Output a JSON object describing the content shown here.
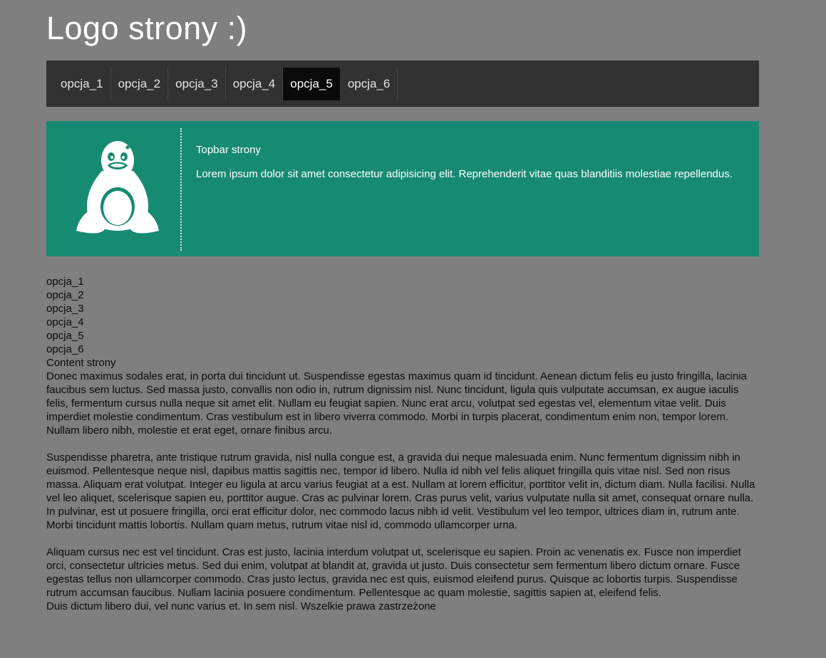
{
  "logo": "Logo strony :)",
  "nav": {
    "items": [
      "opcja_1",
      "opcja_2",
      "opcja_3",
      "opcja_4",
      "opcja_5",
      "opcja_6"
    ],
    "active_index": 4
  },
  "topbar": {
    "icon": "linux-penguin-icon",
    "title": "Topbar strony",
    "text": "Lorem ipsum dolor sit amet consectetur adipisicing elit. Reprehenderit vitae quas blanditiis molestiae repellendus."
  },
  "sidebar_list": [
    "opcja_1",
    "opcja_2",
    "opcja_3",
    "opcja_4",
    "opcja_5",
    "opcja_6"
  ],
  "content": {
    "title": "Content strony",
    "paragraphs": [
      "Donec maximus sodales erat, in porta dui tincidunt ut. Suspendisse egestas maximus quam id tincidunt. Aenean dictum felis eu justo fringilla, lacinia faucibus sem luctus. Sed massa justo, convallis non odio in, rutrum dignissim nisl. Nunc tincidunt, ligula quis vulputate accumsan, ex augue iaculis felis, fermentum cursus nulla neque sit amet elit. Nullam eu feugiat sapien. Nunc erat arcu, volutpat sed egestas vel, elementum vitae velit. Duis imperdiet molestie condimentum. Cras vestibulum est in libero viverra commodo. Morbi in turpis placerat, condimentum enim non, tempor lorem. Nullam libero nibh, molestie et erat eget, ornare finibus arcu.",
      "Suspendisse pharetra, ante tristique rutrum gravida, nisl nulla congue est, a gravida dui neque malesuada enim. Nunc fermentum dignissim nibh in euismod. Pellentesque neque nisl, dapibus mattis sagittis nec, tempor id libero. Nulla id nibh vel felis aliquet fringilla quis vitae nisl. Sed non risus massa. Aliquam erat volutpat. Integer eu ligula at arcu varius feugiat at a est. Nullam at lorem efficitur, porttitor velit in, dictum diam. Nulla facilisi. Nulla vel leo aliquet, scelerisque sapien eu, porttitor augue. Cras ac pulvinar lorem. Cras purus velit, varius vulputate nulla sit amet, consequat ornare nulla. In pulvinar, est ut posuere fringilla, orci erat efficitur dolor, nec commodo lacus nibh id velit. Vestibulum vel leo tempor, ultrices diam in, rutrum ante. Morbi tincidunt mattis lobortis. Nullam quam metus, rutrum vitae nisl id, commodo ullamcorper urna.",
      "Aliquam cursus nec est vel tincidunt. Cras est justo, lacinia interdum volutpat ut, scelerisque eu sapien. Proin ac venenatis ex. Fusce non imperdiet orci, consectetur ultricies metus. Sed dui enim, volutpat at blandit at, gravida ut justo. Duis consectetur sem fermentum libero dictum ornare. Fusce egestas tellus non ullamcorper commodo. Cras justo lectus, gravida nec est quis, euismod eleifend purus. Quisque ac lobortis turpis. Suspendisse rutrum accumsan faucibus. Nullam lacinia posuere condimentum. Pellentesque ac quam molestie, sagittis sapien at, eleifend felis."
    ]
  },
  "footer": "Duis dictum libero dui, vel nunc varius et. In sem nisl. Wszelkie prawa zastrzeżone",
  "colors": {
    "page_bg": "#7f7f7f",
    "nav_bg": "#323232",
    "nav_active_bg": "#0a0a0a",
    "topbar_bg": "#178a72"
  }
}
